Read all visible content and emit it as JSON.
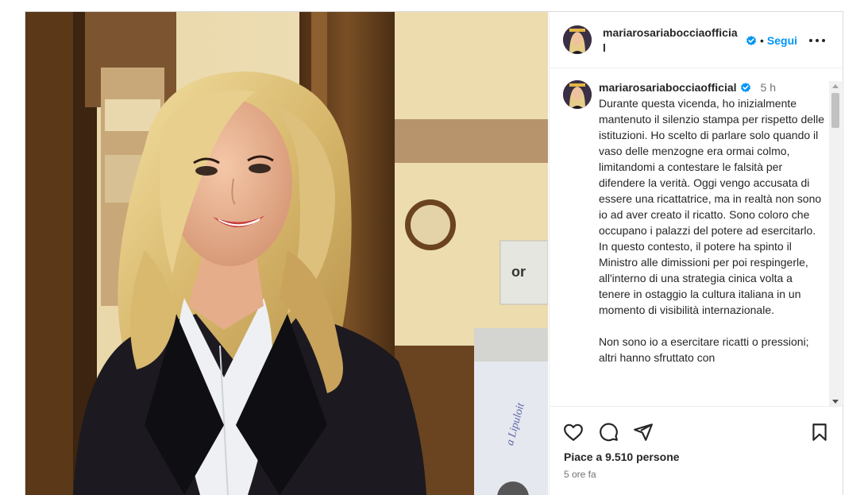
{
  "post": {
    "username": "mariarosariabocciaofficial",
    "header_username_line1": "mariarosariabocciaofficia",
    "header_username_line2": "l",
    "separator": "•",
    "follow_label": "Segui",
    "caption_time": "5 h",
    "caption_text": "Durante questa vicenda, ho inizialmente mantenuto il silenzio stampa per rispetto delle istituzioni. Ho scelto di parlare solo quando il vaso delle menzogne era ormai colmo, limitandomi a contestare le falsità per difendere la verità. Oggi vengo accusata di essere una ricattatrice, ma in realtà non sono io ad aver creato il ricatto. Sono coloro che occupano i palazzi del potere ad esercitarlo. In questo contesto, il potere ha spinto il Ministro alle dimissioni per poi respingerle, all'interno di una strategia cinica volta a tenere in ostaggio la cultura italiana in un momento di visibilità internazionale.\n\nNon sono io a esercitare ricatti o pressioni; altri hanno sfruttato con",
    "likes_text": "Piace a 9.510 persone",
    "time_ago": "5 ore fa"
  },
  "photo": {
    "sign_text": "or",
    "plaque_text": "a Lipuloit"
  },
  "icons": {
    "verified": "verified-badge-icon",
    "more": "more-options-icon",
    "like": "heart-icon",
    "comment": "comment-icon",
    "share": "share-icon",
    "save": "bookmark-icon"
  },
  "colors": {
    "accent": "#0095f6",
    "text": "#262626",
    "secondary": "#737373",
    "border": "#dbdbdb"
  }
}
